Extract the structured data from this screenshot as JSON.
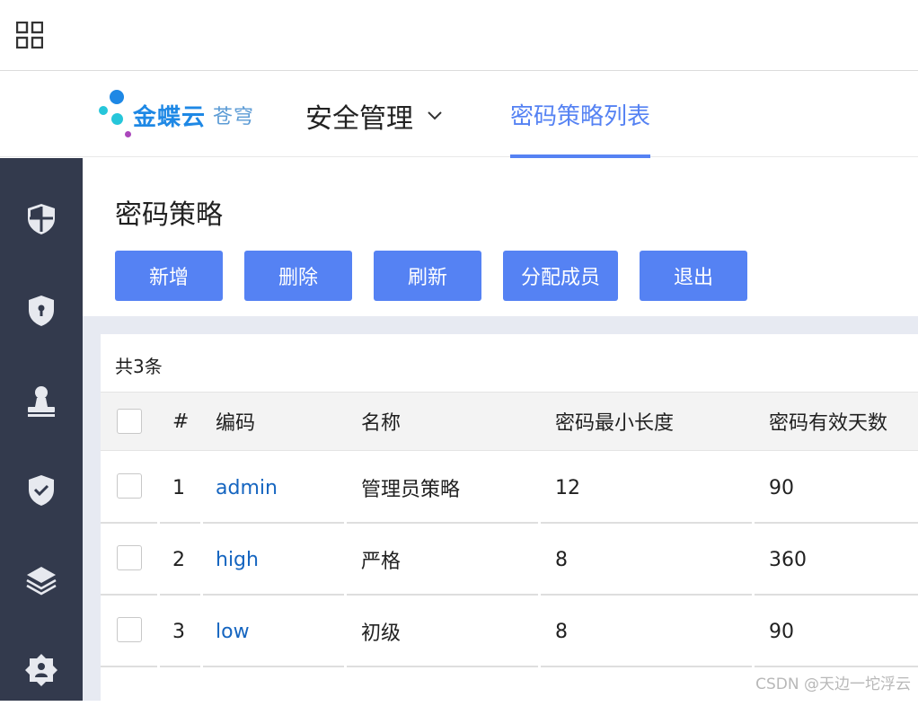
{
  "topbar": {
    "apps_icon": "apps-grid-icon"
  },
  "header": {
    "menu_icon": "app-grid-icon",
    "logo": {
      "brand": "金蝶云",
      "sub": "苍穹"
    },
    "app_title": "安全管理",
    "app_title_icon": "chevron-down-icon",
    "active_tab": "密码策略列表"
  },
  "sidebar": {
    "items": [
      {
        "icon": "shield-quadrant-icon"
      },
      {
        "icon": "shield-lock-icon"
      },
      {
        "icon": "stamp-user-icon"
      },
      {
        "icon": "shield-check-icon"
      },
      {
        "icon": "layers-icon"
      },
      {
        "icon": "gear-user-icon"
      }
    ]
  },
  "page": {
    "title": "密码策略",
    "buttons": {
      "add": "新增",
      "delete": "删除",
      "refresh": "刷新",
      "assign": "分配成员",
      "exit": "退出"
    }
  },
  "table": {
    "count_text": "共3条",
    "columns": [
      "#",
      "编码",
      "名称",
      "密码最小长度",
      "密码有效天数"
    ],
    "rows": [
      {
        "index": "1",
        "code": "admin",
        "name": "管理员策略",
        "min_length": "12",
        "valid_days": "90"
      },
      {
        "index": "2",
        "code": "high",
        "name": "严格",
        "min_length": "8",
        "valid_days": "360"
      },
      {
        "index": "3",
        "code": "low",
        "name": "初级",
        "min_length": "8",
        "valid_days": "90"
      }
    ]
  },
  "watermark": "CSDN @天边一坨浮云",
  "colors": {
    "accent": "#5582f3",
    "sidebar": "#333a4d",
    "link": "#1565c0"
  }
}
